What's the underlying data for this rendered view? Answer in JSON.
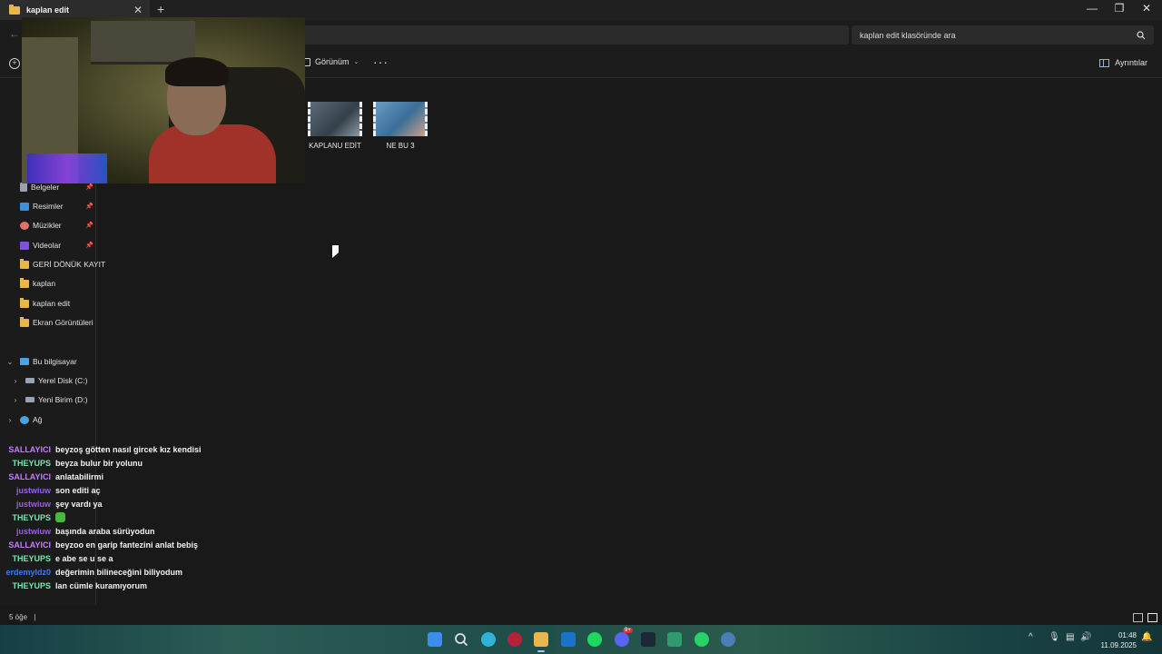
{
  "window": {
    "tab_title": "kaplan edit",
    "tab_close": "✕",
    "new_tab": "+",
    "minimize": "—",
    "maximize": "❐",
    "close": "✕"
  },
  "address": {
    "back": "←",
    "search_placeholder": "kaplan edit klasöründe ara"
  },
  "toolbar": {
    "new_icon": "+",
    "view_label": "Görünüm",
    "view_chevron": "⌄",
    "more": "···",
    "details_label": "Ayrıntılar"
  },
  "sidebar": {
    "quick_access": [
      {
        "label": "Belgeler",
        "icon": "documents-icon",
        "pinned": true
      },
      {
        "label": "Resimler",
        "icon": "pictures-icon",
        "pinned": true
      },
      {
        "label": "Müzikler",
        "icon": "music-icon",
        "pinned": true
      },
      {
        "label": "Videolar",
        "icon": "videos-icon",
        "pinned": true
      },
      {
        "label": "GERİ DÖNÜK KAYIT",
        "icon": "folder-icon",
        "pinned": false
      },
      {
        "label": "kaplan",
        "icon": "folder-icon",
        "pinned": false
      },
      {
        "label": "kaplan edit",
        "icon": "folder-icon",
        "pinned": false
      },
      {
        "label": "Ekran Görüntüleri",
        "icon": "folder-icon",
        "pinned": false
      }
    ],
    "pin_glyph": "📌",
    "this_pc": "Bu bilgisayar",
    "drives": [
      {
        "label": "Yerel Disk (C:)"
      },
      {
        "label": "Yeni Birim (D:)"
      }
    ],
    "network": "Ağ"
  },
  "files": [
    {
      "name": "KAPLANU EDİT"
    },
    {
      "name": "NE BU 3"
    }
  ],
  "chat": [
    {
      "user": "SALLAYICI",
      "color": "#c77dff",
      "message": "beyzoş götten nasıl gircek kız kendisi"
    },
    {
      "user": "THEYUPS",
      "color": "#7fe3b0",
      "message": "beyza bulur bir yolunu"
    },
    {
      "user": "SALLAYICI",
      "color": "#c77dff",
      "message": "anlatabilirmi"
    },
    {
      "user": "justwiuw",
      "color": "#9b5cf0",
      "message": "son editi aç"
    },
    {
      "user": "justwiuw",
      "color": "#9b5cf0",
      "message": "şey vardı ya"
    },
    {
      "user": "THEYUPS",
      "color": "#7fe3b0",
      "message": "",
      "emote": true
    },
    {
      "user": "justwiuw",
      "color": "#9b5cf0",
      "message": "başında araba sürüyodun"
    },
    {
      "user": "SALLAYICI",
      "color": "#c77dff",
      "message": "beyzoo en garip fantezini anlat bebiş"
    },
    {
      "user": "THEYUPS",
      "color": "#7fe3b0",
      "message": "e abe se u se a"
    },
    {
      "user": "erdemyldz0",
      "color": "#3d7bf0",
      "message": "değerimin bilineceğini biliyodum"
    },
    {
      "user": "THEYUPS",
      "color": "#7fe3b0",
      "message": "lan cümle kuramıyorum"
    }
  ],
  "status": {
    "item_count": "5 öğe",
    "separator": "|"
  },
  "taskbar": {
    "time": "01:48",
    "date": "11.09.2025",
    "tray_chevron": "^",
    "badge": "9+",
    "colors": {
      "start": "#3b8eea",
      "search": "#e0e0e0",
      "edge": "#2fb2d6",
      "opera": "#b5203a",
      "explorer": "#e8b64a",
      "outlook": "#1a73c8",
      "spotify": "#1ed760",
      "discord": "#5865f2",
      "steam": "#1b2838",
      "app": "#2e9a6e",
      "whatsapp": "#25d366",
      "network_app": "#4a7fb5"
    }
  }
}
